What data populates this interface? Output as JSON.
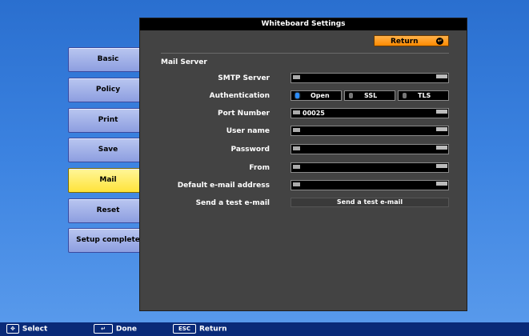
{
  "window": {
    "title": "Whiteboard Settings"
  },
  "return_button": {
    "label": "Return"
  },
  "menu": [
    {
      "label": "Basic"
    },
    {
      "label": "Policy"
    },
    {
      "label": "Print"
    },
    {
      "label": "Save"
    },
    {
      "label": "Mail",
      "active": true
    },
    {
      "label": "Reset"
    },
    {
      "label": "Setup complete"
    }
  ],
  "mail": {
    "section_title": "Mail Server",
    "smtp_server": {
      "label": "SMTP Server",
      "value": ""
    },
    "authentication": {
      "label": "Authentication",
      "options": [
        "Open",
        "SSL",
        "TLS"
      ],
      "selected": "Open"
    },
    "port_number": {
      "label": "Port Number",
      "value": "00025"
    },
    "user_name": {
      "label": "User name",
      "value": ""
    },
    "password": {
      "label": "Password",
      "value": ""
    },
    "from": {
      "label": "From",
      "value": ""
    },
    "default_email": {
      "label": "Default e-mail address",
      "value": ""
    },
    "send_test": {
      "label": "Send a test e-mail",
      "button": "Send a test e-mail"
    }
  },
  "footer": {
    "select": {
      "key": "✥",
      "label": "Select"
    },
    "done": {
      "key": "↵",
      "label": "Done"
    },
    "return": {
      "key": "ESC",
      "label": "Return"
    }
  },
  "colors": {
    "background": "#3b82e0",
    "panel": "#434343",
    "accent_return": "#ff8a00",
    "menu_active": "#ffe33a",
    "menu_default": "#a8b5ea",
    "radio_selected": "#2a8dff"
  }
}
